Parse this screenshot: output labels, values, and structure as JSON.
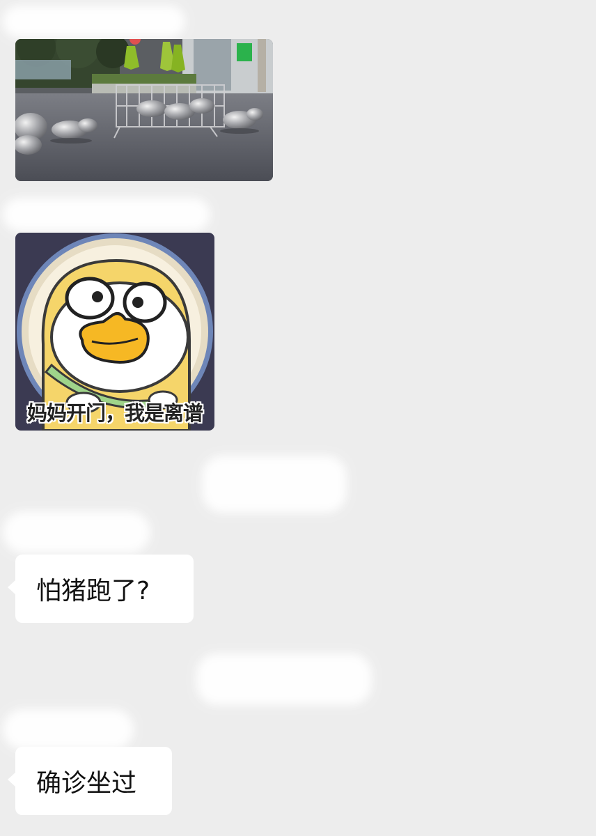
{
  "theme": {
    "background": "#ededed",
    "bubble": "#ffffff",
    "text": "#111111"
  },
  "messages": [
    {
      "type": "image",
      "name": "photo-message",
      "icon": "photo-plaza-pig-sculptures"
    },
    {
      "type": "sticker",
      "name": "sticker-message",
      "icon": "duck-sticker",
      "caption": "妈妈开门，我是离谱"
    },
    {
      "type": "text",
      "name": "text-message-1",
      "text": "怕猪跑了?"
    },
    {
      "type": "text",
      "name": "text-message-2",
      "text": "确诊坐过"
    }
  ]
}
